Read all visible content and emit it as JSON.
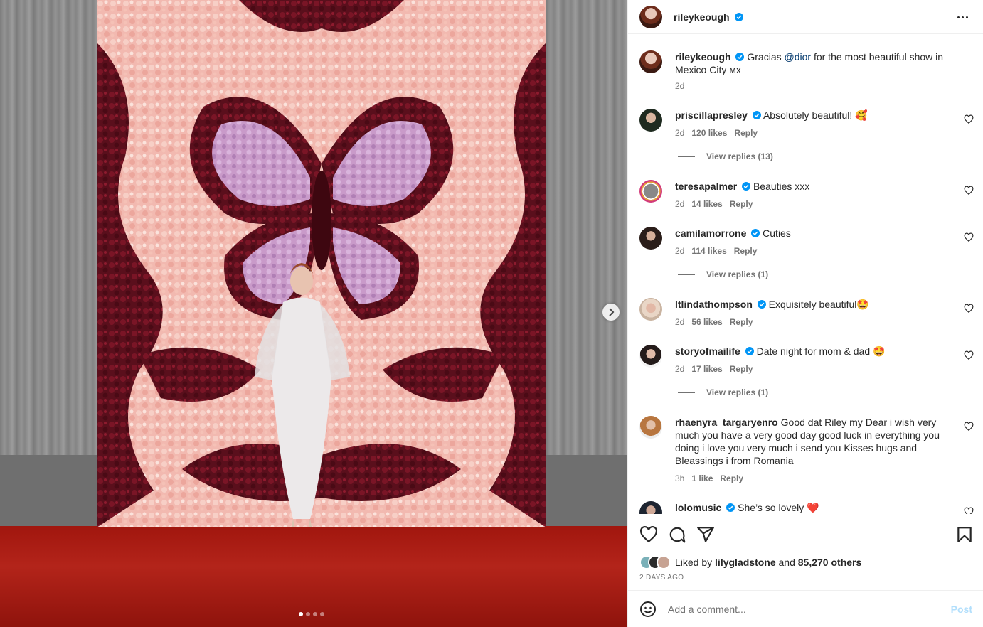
{
  "post": {
    "author": "rileykeough",
    "caption_text": "Gracias",
    "caption_mention": "@dior",
    "caption_rest": "for the most beautiful show in Mexico City ᴍx",
    "caption_age": "2d",
    "slides": 4,
    "active_slide": 1
  },
  "comments": [
    {
      "user": "priscillapresley",
      "verified": true,
      "text": "Absolutely beautiful! 🥰",
      "age": "2d",
      "likes": "120 likes",
      "reply": "Reply",
      "view_replies": "View replies (13)"
    },
    {
      "user": "teresapalmer",
      "verified": true,
      "text": "Beauties xxx",
      "age": "2d",
      "likes": "14 likes",
      "reply": "Reply"
    },
    {
      "user": "camilamorrone",
      "verified": true,
      "text": "Cuties",
      "age": "2d",
      "likes": "114 likes",
      "reply": "Reply",
      "view_replies": "View replies (1)"
    },
    {
      "user": "ltlindathompson",
      "verified": true,
      "text": "Exquisitely beautiful🤩",
      "age": "2d",
      "likes": "56 likes",
      "reply": "Reply"
    },
    {
      "user": "storyofmailife",
      "verified": true,
      "text": "Date night for mom & dad 🤩",
      "age": "2d",
      "likes": "17 likes",
      "reply": "Reply",
      "view_replies": "View replies (1)"
    },
    {
      "user": "rhaenyra_targaryenro",
      "verified": false,
      "text": "Good dat Riley my Dear i wish very much you have a very good day good luck in everything you doing i love you very much i send you Kisses hugs and Bleassings i from Romania",
      "age": "3h",
      "likes": "1 like",
      "reply": "Reply"
    },
    {
      "user": "lolomusic",
      "verified": true,
      "text": "She’s so lovely ❤️"
    }
  ],
  "likes_summary": {
    "prefix": "Liked by",
    "user": "lilygladstone",
    "and": "and",
    "others": "85,270 others"
  },
  "post_date": "2 DAYS AGO",
  "comment_box": {
    "placeholder": "Add a comment...",
    "post_label": "Post"
  },
  "icons": {
    "like": "heart-icon",
    "comment": "comment-icon",
    "share": "share-icon",
    "save": "bookmark-icon",
    "emoji": "emoji-icon",
    "more": "more-options-icon",
    "next": "chevron-right-icon",
    "verified": "verified-badge-icon"
  },
  "colors": {
    "verified": "#0095f6",
    "link": "#00376b",
    "post_button": "#b2dffc",
    "secondary_text": "#737373"
  }
}
